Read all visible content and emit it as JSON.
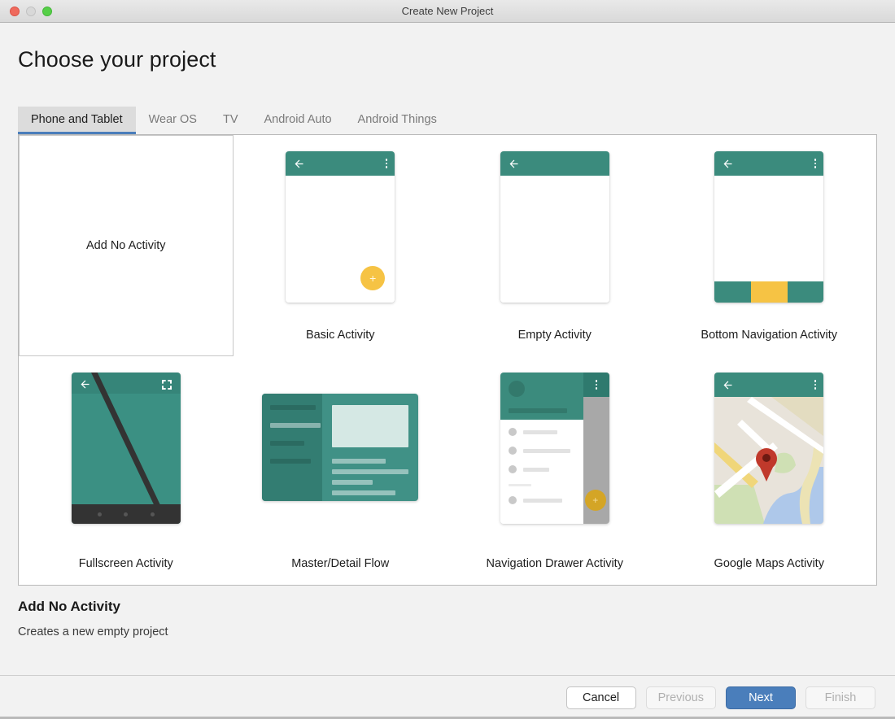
{
  "window": {
    "title": "Create New Project",
    "traffic_lights": [
      "close-button",
      "minimize-button",
      "maximize-button"
    ]
  },
  "page": {
    "heading": "Choose your project"
  },
  "tabs": [
    {
      "label": "Phone and Tablet",
      "active": true
    },
    {
      "label": "Wear OS",
      "active": false
    },
    {
      "label": "TV",
      "active": false
    },
    {
      "label": "Android Auto",
      "active": false
    },
    {
      "label": "Android Things",
      "active": false
    }
  ],
  "templates": [
    {
      "label": "Add No Activity",
      "selected": true,
      "thumb": "none"
    },
    {
      "label": "Basic Activity",
      "selected": false,
      "thumb": "basic"
    },
    {
      "label": "Empty Activity",
      "selected": false,
      "thumb": "empty"
    },
    {
      "label": "Bottom Navigation Activity",
      "selected": false,
      "thumb": "bottom-nav"
    },
    {
      "label": "Fullscreen Activity",
      "selected": false,
      "thumb": "fullscreen"
    },
    {
      "label": "Master/Detail Flow",
      "selected": false,
      "thumb": "master-detail"
    },
    {
      "label": "Navigation Drawer Activity",
      "selected": false,
      "thumb": "nav-drawer"
    },
    {
      "label": "Google Maps Activity",
      "selected": false,
      "thumb": "maps"
    }
  ],
  "description": {
    "title": "Add No Activity",
    "text": "Creates a new empty project"
  },
  "footer": {
    "cancel": "Cancel",
    "previous": "Previous",
    "next": "Next",
    "finish": "Finish"
  },
  "colors": {
    "accent_blue": "#4a7ebb",
    "teal": "#3b8b7d",
    "teal_dark": "#2f7a6e",
    "amber": "#f6c344",
    "amber_dark": "#d4a526",
    "panel_bg": "#ffffff",
    "window_bg": "#f2f2f2",
    "map_pin_red": "#c0392b"
  }
}
